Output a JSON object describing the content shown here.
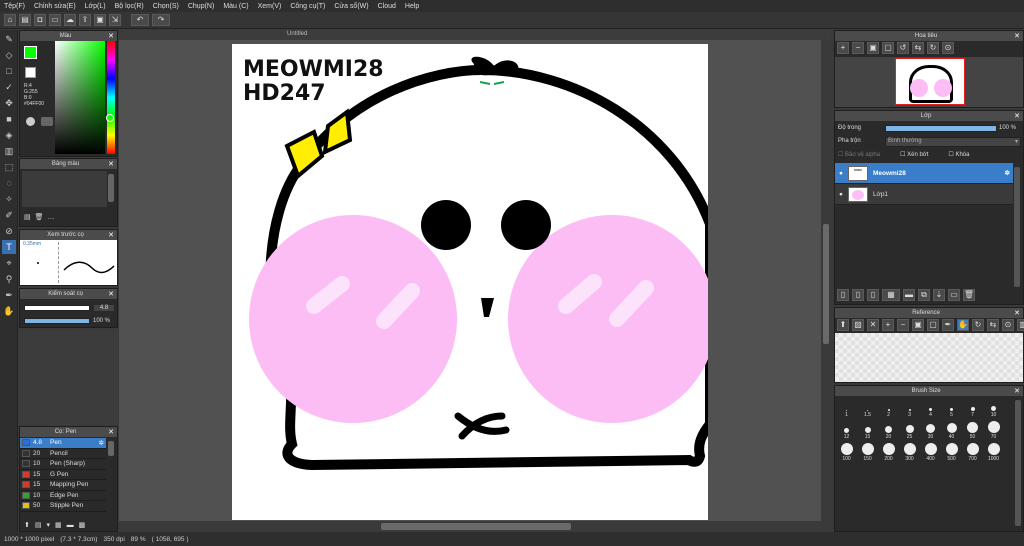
{
  "menu": [
    "Tệp(F)",
    "Chỉnh sửa(E)",
    "Lớp(L)",
    "Bộ lọc(R)",
    "Chọn(S)",
    "Chụp(N)",
    "Màu (C)",
    "Xem(V)",
    "Công cụ(T)",
    "Cửa sổ(W)",
    "Cloud",
    "Help"
  ],
  "color_panel": {
    "title": "Màu",
    "r": "R:4",
    "g": "G:255",
    "b": "B:0",
    "hex": "#04FF00"
  },
  "swatch_panel": {
    "title": "Bảng màu"
  },
  "preview_panel": {
    "title": "Xem trước cọ",
    "size": "0.35mm"
  },
  "brush_ctrl": {
    "title": "Kiểm soát cọ",
    "size_value": "4.8",
    "opacity_value": "100 %"
  },
  "pen_panel": {
    "title": "Cọ: Pen",
    "items": [
      {
        "size": "4.8",
        "name": "Pen",
        "color": "#2b6fd6",
        "active": true
      },
      {
        "size": "20",
        "name": "Pencil",
        "color": "#333333"
      },
      {
        "size": "10",
        "name": "Pen (Sharp)",
        "color": "#333333"
      },
      {
        "size": "15",
        "name": "G Pen",
        "color": "#d83a2a"
      },
      {
        "size": "15",
        "name": "Mapping Pen",
        "color": "#d83a2a"
      },
      {
        "size": "10",
        "name": "Edge Pen",
        "color": "#2fa52f"
      },
      {
        "size": "50",
        "name": "Stipple Pen",
        "color": "#e0c020"
      }
    ]
  },
  "canvas": {
    "tab": "Untitled",
    "text_line1": "MEOWMI28",
    "text_line2": "HD247"
  },
  "navigator": {
    "title": "Hoa tiêu"
  },
  "layer_panel": {
    "title": "Lớp",
    "opacity_label": "Độ trong",
    "opacity_value": "100 %",
    "blend_label": "Pha trộn",
    "blend_value": "Bình thường",
    "protect_alpha": "Bảo vệ alpha",
    "clipping": "Xén bớt",
    "lock": "Khóa",
    "layers": [
      {
        "name": "Meowmi28",
        "selected": true
      },
      {
        "name": "Lớp1",
        "selected": false
      }
    ]
  },
  "reference": {
    "title": "Reference"
  },
  "brush_size": {
    "title": "Brush Size",
    "row1": [
      "1",
      "1.5",
      "2",
      "3",
      "4",
      "5",
      "7",
      "10"
    ],
    "row2": [
      "12",
      "15",
      "20",
      "25",
      "30",
      "40",
      "50",
      "70"
    ],
    "row3": [
      "100",
      "150",
      "200",
      "300",
      "400",
      "500",
      "700",
      "1000"
    ]
  },
  "status": {
    "dims": "1000 * 1000 pixel",
    "cm": "(7.3 * 7.3cm)",
    "dpi": "350 dpi",
    "zoom": "89 %",
    "coords": "( 1058, 695 )"
  },
  "colors": {
    "accent": "#3a6fb0",
    "primary": "#04FF00",
    "secondary": "#ff2020",
    "cheek": "#fbb8f2",
    "bow": "#ffee00"
  }
}
